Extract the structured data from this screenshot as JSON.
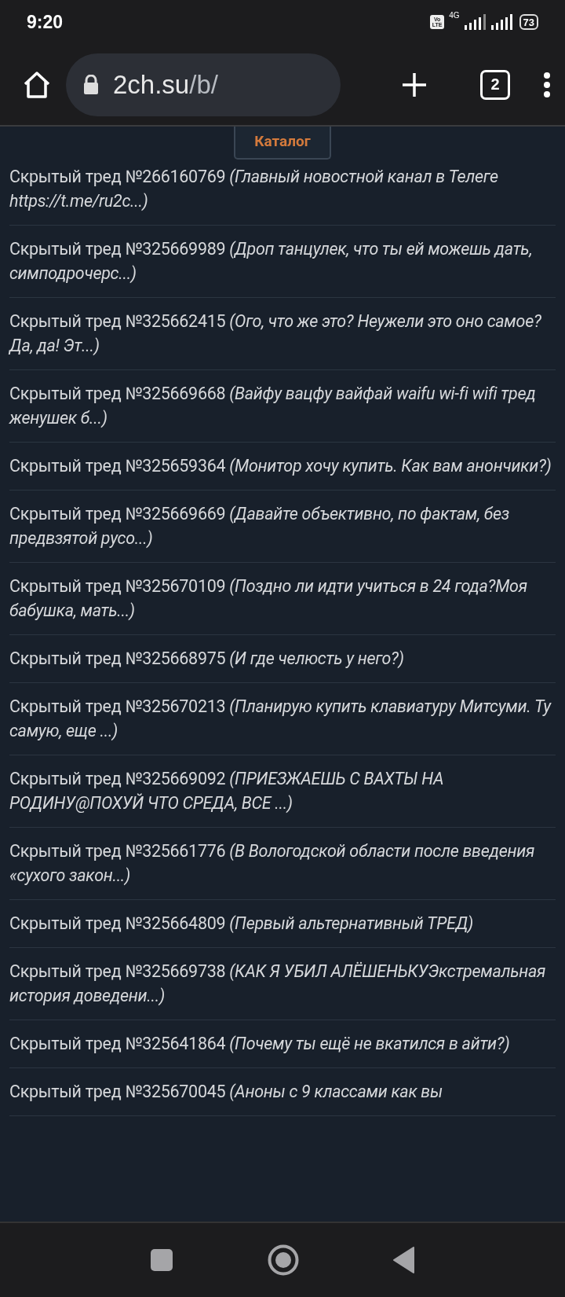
{
  "status_bar": {
    "time": "9:20",
    "battery": "73",
    "network": "4G",
    "volte": "Vo LTE"
  },
  "browser": {
    "url_host": "2ch.su",
    "url_path": "/b/",
    "tab_count": "2"
  },
  "catalog_button": "Каталог",
  "threads": [
    {
      "text": "Скрытый тред №266160769 *(Главный новостной канал в Телеге https://t.me/ru2c...)*"
    },
    {
      "text": "Скрытый тред №325669989 *(Дроп танцулек, что ты ей можешь дать, симподрочерс...)*"
    },
    {
      "text": "Скрытый тред №325662415 *(Ого, что же это? Неужели это оно самое? Да, да! Эт...)*"
    },
    {
      "text": "Скрытый тред №325669668 *(Вайфу вацфу вайфай waifu wi-fi wifi тред женушек б...)*"
    },
    {
      "text": "Скрытый тред №325659364 *(Монитор хочу купить. Как вам анончики?)*"
    },
    {
      "text": "Скрытый тред №325669669 *(Давайте объективно, по фактам, без предвзятой русо...)*"
    },
    {
      "text": "Скрытый тред №325670109 *(Поздно ли идти учиться в 24 года?Моя бабушка, мать...)*"
    },
    {
      "text": "Скрытый тред №325668975 *(И где челюсть у него?)*"
    },
    {
      "text": "Скрытый тред №325670213 *(Планирую купить клавиатуру Митсуми. Ту самую, еще ...)*"
    },
    {
      "text": "Скрытый тред №325669092 *(ПРИЕЗЖАЕШЬ С ВАХТЫ НА РОДИНУ@ПОХУЙ ЧТО СРЕДА, ВСЕ ...)*"
    },
    {
      "text": "Скрытый тред №325661776 *(В Вологодской области после введения «сухого закон...)*"
    },
    {
      "text": "Скрытый тред №325664809 *(Первый альтернативный ТРЕД)*"
    },
    {
      "text": "Скрытый тред №325669738 *(КАК Я УБИЛ АЛЁШЕНЬКУЭкстремальная история доведени...)*"
    },
    {
      "text": "Скрытый тред №325641864 *(Почему ты ещё не вкатился в айти?)*"
    },
    {
      "text": "Скрытый тред №325670045 *(Аноны с 9 классами как вы*"
    }
  ]
}
